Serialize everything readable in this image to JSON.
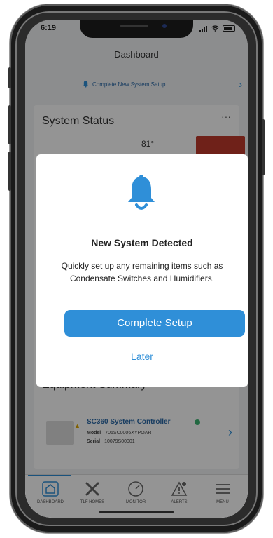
{
  "status_bar": {
    "time": "6:19"
  },
  "header": {
    "title": "Dashboard"
  },
  "banner": {
    "text": "Complete New System Setup"
  },
  "system_status": {
    "title": "System Status",
    "more": "···",
    "temperature": "81°"
  },
  "equipment": {
    "title": "Equipment Summary",
    "name": "SC360 System Controller",
    "model_label": "Model",
    "model_value": "705SC0006XYPOAR",
    "serial_label": "Serial",
    "serial_value": "10079S00001"
  },
  "tabs": [
    {
      "label": "DASHBOARD",
      "icon": "home-icon"
    },
    {
      "label": "TLF HOMES",
      "icon": "fan-icon"
    },
    {
      "label": "MONITOR",
      "icon": "gauge-icon"
    },
    {
      "label": "ALERTS",
      "icon": "alert-icon"
    },
    {
      "label": "MENU",
      "icon": "menu-icon"
    }
  ],
  "modal": {
    "title": "New System Detected",
    "body": "Quickly set up any remaining items such as Condensate Switches and Humidifiers.",
    "primary_button": "Complete Setup",
    "secondary_link": "Later"
  },
  "colors": {
    "accent": "#2f8fd8",
    "alert_red": "#c0392b",
    "ok_green": "#3cb371"
  }
}
